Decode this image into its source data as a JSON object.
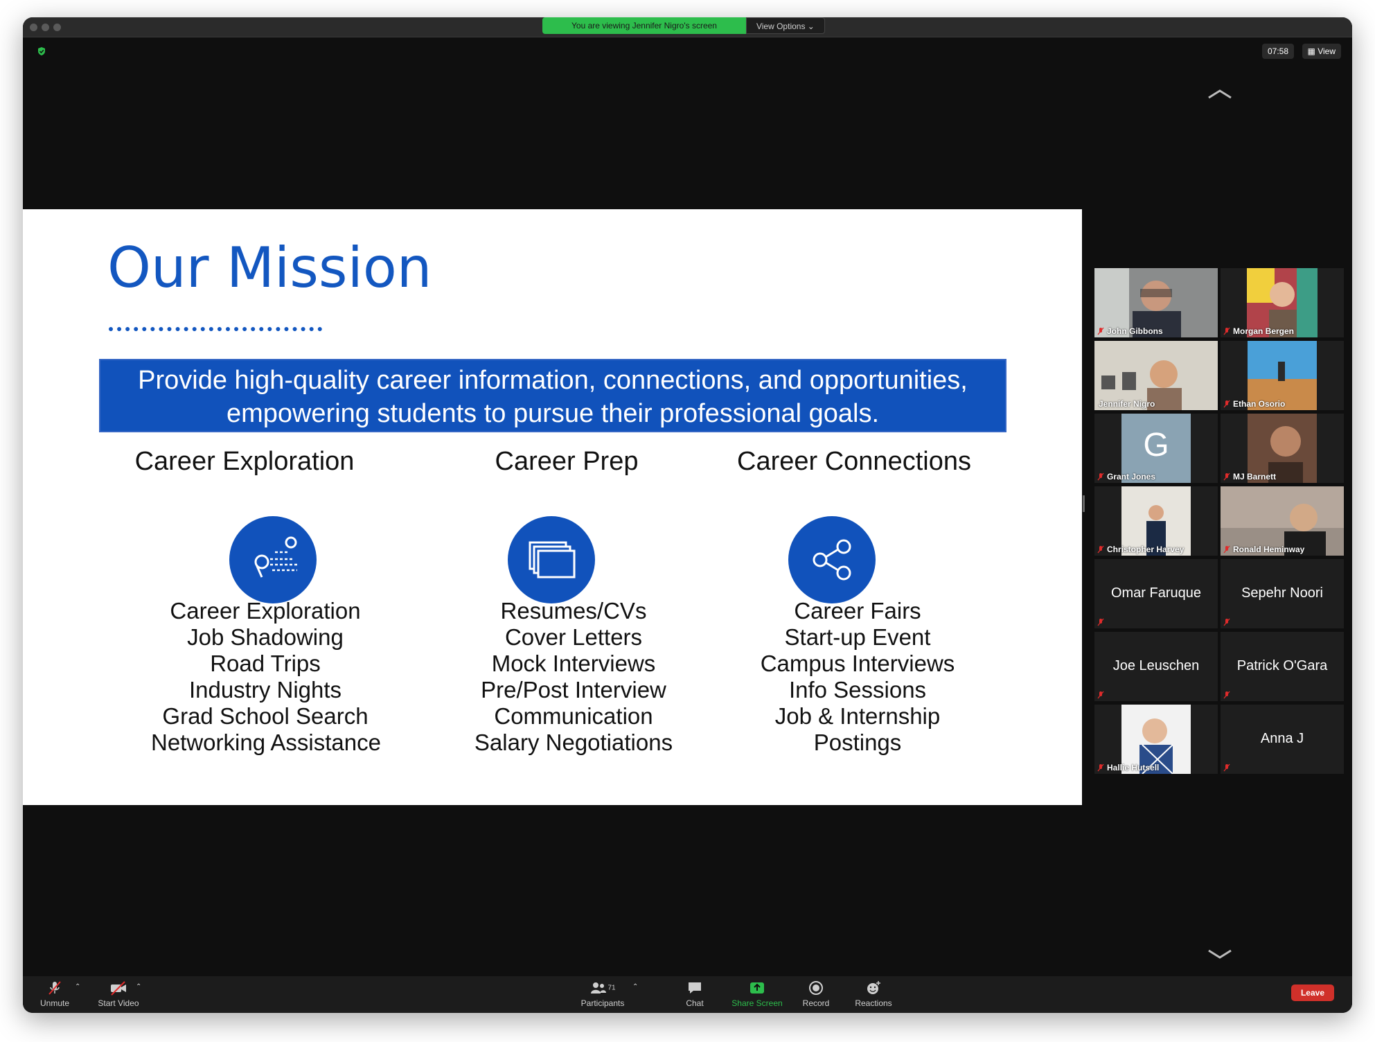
{
  "banner": {
    "viewing": "You are viewing Jennifer Nigro's screen",
    "view_options": "View Options"
  },
  "top": {
    "timer": "07:58",
    "view": "View"
  },
  "slide": {
    "title": "Our Mission",
    "mission_line1": "Provide high-quality career information, connections, and opportunities,",
    "mission_line2": "empowering students to pursue their professional goals.",
    "columns": [
      {
        "heading": "Career Exploration",
        "icon": "map-route-icon",
        "items": [
          "Career Exploration",
          "Job Shadowing",
          "Road Trips",
          "Industry Nights",
          "Grad School Search",
          "Networking Assistance"
        ]
      },
      {
        "heading": "Career Prep",
        "icon": "stacked-windows-icon",
        "items": [
          "Resumes/CVs",
          "Cover Letters",
          "Mock Interviews",
          "Pre/Post Interview",
          "Communication",
          "Salary Negotiations"
        ]
      },
      {
        "heading": "Career Connections",
        "icon": "share-icon",
        "items": [
          "Career Fairs",
          "Start-up Event",
          "Campus Interviews",
          "Info Sessions",
          "Job & Internship",
          "Postings"
        ]
      }
    ]
  },
  "participants": [
    {
      "name": "John Gibbons"
    },
    {
      "name": "Morgan Bergen"
    },
    {
      "name": "Jennifer Nigro"
    },
    {
      "name": "Ethan Osorio"
    },
    {
      "name": "Grant Jones",
      "initial": "G"
    },
    {
      "name": "MJ Barnett"
    },
    {
      "name": "Christopher Harvey"
    },
    {
      "name": "Ronald Heminway"
    },
    {
      "name": "Omar Faruque"
    },
    {
      "name": "Sepehr Noori"
    },
    {
      "name": "Joe Leuschen"
    },
    {
      "name": "Patrick O'Gara"
    },
    {
      "name": "Hallie Hutsell"
    },
    {
      "name": "Anna J"
    }
  ],
  "toolbar": {
    "unmute": "Unmute",
    "start_video": "Start Video",
    "participants": "Participants",
    "participants_count": "71",
    "chat": "Chat",
    "share_screen": "Share Screen",
    "record": "Record",
    "reactions": "Reactions",
    "leave": "Leave"
  },
  "colors": {
    "slide_blue": "#1152bb",
    "title_blue": "#1357c0",
    "share_green": "#2dbd4c",
    "leave_red": "#d0302a",
    "speaker_outline": "#b9d86b"
  }
}
